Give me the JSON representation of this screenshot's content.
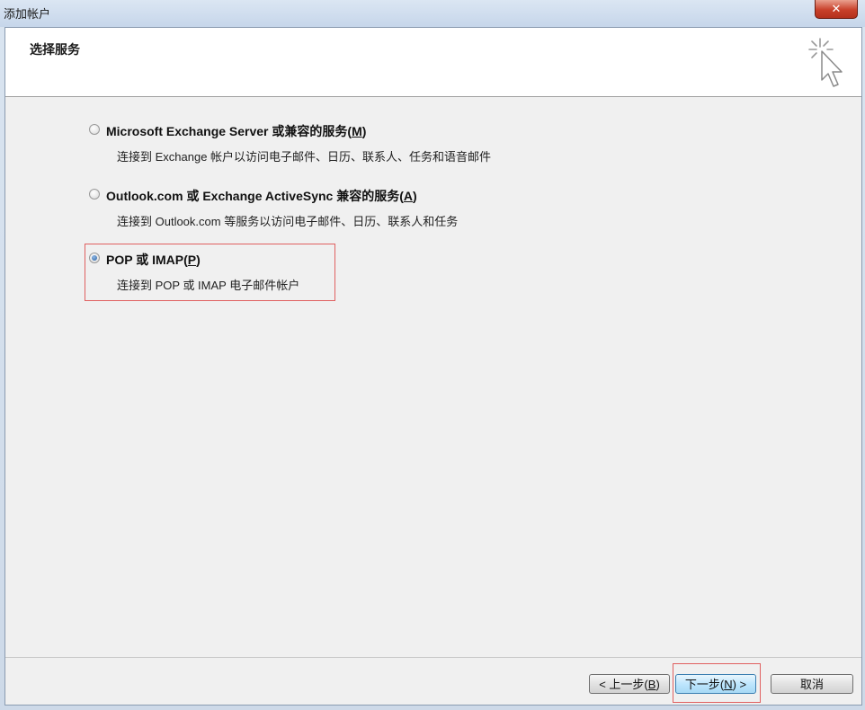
{
  "window": {
    "title": "添加帐户",
    "close_glyph": "✕"
  },
  "header": {
    "title": "选择服务",
    "icon": "wizard-cursor-icon"
  },
  "options": [
    {
      "label_main": "Microsoft Exchange Server 或兼容的服务(",
      "label_key": "M",
      "label_end": ")",
      "description": "连接到 Exchange 帐户以访问电子邮件、日历、联系人、任务和语音邮件",
      "selected": false
    },
    {
      "label_main": "Outlook.com 或 Exchange ActiveSync 兼容的服务(",
      "label_key": "A",
      "label_end": ")",
      "description": "连接到 Outlook.com 等服务以访问电子邮件、日历、联系人和任务",
      "selected": false
    },
    {
      "label_main": "POP 或 IMAP(",
      "label_key": "P",
      "label_end": ")",
      "description": "连接到 POP 或 IMAP 电子邮件帐户",
      "selected": true
    }
  ],
  "footer": {
    "back": {
      "prefix": "< 上一步(",
      "key": "B",
      "suffix": ")"
    },
    "next": {
      "prefix": "下一步(",
      "key": "N",
      "suffix": ") >"
    },
    "cancel": "取消"
  },
  "colors": {
    "highlight": "#e06060",
    "accent": "#3c7fb1"
  }
}
